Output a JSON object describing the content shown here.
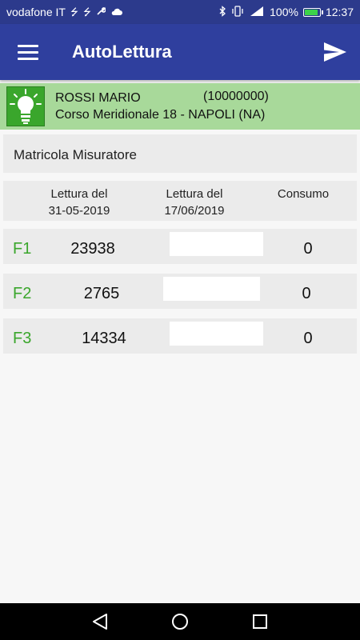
{
  "statusbar": {
    "carrier": "vodafone IT",
    "battery_percent": "100%",
    "battery_level": 1.0,
    "time": "12:37",
    "left_icons": [
      "usb-icon",
      "usb-icon",
      "wrench-icon",
      "cloud-icon"
    ],
    "right_icons": [
      "bluetooth-icon",
      "vibrate-icon",
      "signal-icon"
    ]
  },
  "appbar": {
    "title": "AutoLettura"
  },
  "customer": {
    "name": "ROSSI MARIO",
    "code": "(10000000)",
    "address": "Corso Meridionale 18 - NAPOLI (NA)"
  },
  "matricola": {
    "label": "Matricola Misuratore"
  },
  "table": {
    "col_prev_line1": "Lettura del",
    "col_prev_line2": "31-05-2019",
    "col_new_line1": "Lettura del",
    "col_new_line2": "17/06/2019",
    "col_consumo": "Consumo",
    "rows": [
      {
        "fascia": "F1",
        "previous": "23938",
        "new_value": "",
        "consumo": "0"
      },
      {
        "fascia": "F2",
        "previous": "2765",
        "new_value": "",
        "consumo": "0"
      },
      {
        "fascia": "F3",
        "previous": "14334",
        "new_value": "",
        "consumo": "0"
      }
    ]
  },
  "colors": {
    "status_bar": "#2c3a8c",
    "app_bar": "#2f3f9e",
    "customer_bg": "#a8d99a",
    "accent_green": "#3aa62c",
    "row_bg": "#ebebeb"
  },
  "navbar": {
    "icons": [
      "back-icon",
      "home-icon",
      "recent-apps-icon"
    ]
  }
}
